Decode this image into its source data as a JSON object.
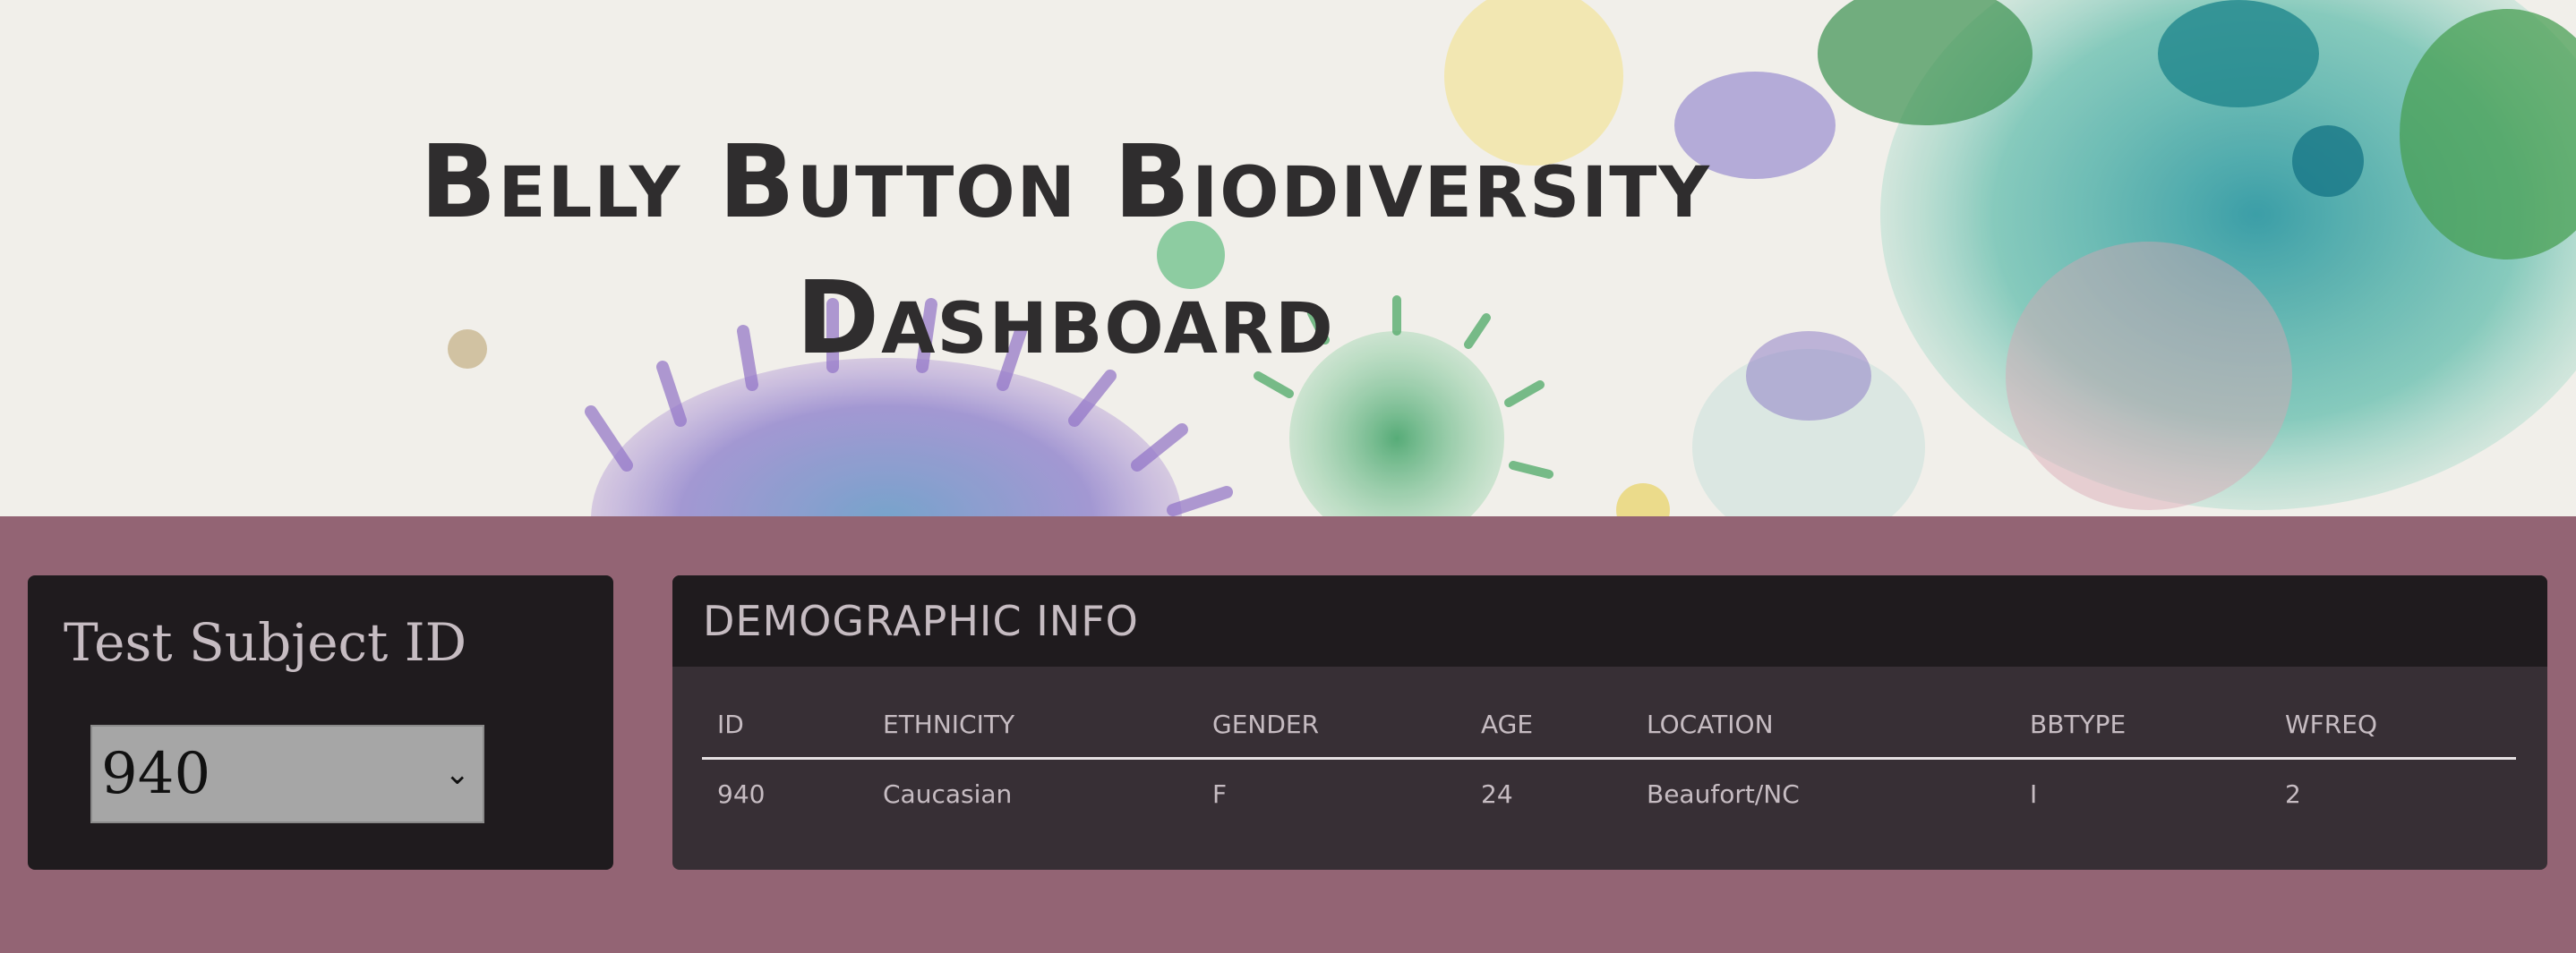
{
  "header": {
    "title_line1": "Belly Button Biodiversity",
    "title_line2": "Dashboard"
  },
  "subject": {
    "title": "Test Subject ID",
    "selected": "940"
  },
  "demographics": {
    "heading": "DEMOGRAPHIC INFO",
    "columns": [
      "ID",
      "ETHNICITY",
      "GENDER",
      "AGE",
      "LOCATION",
      "BBTYPE",
      "WFREQ"
    ],
    "rows": [
      [
        "940",
        "Caucasian",
        "F",
        "24",
        "Beaufort/NC",
        "I",
        "2"
      ]
    ]
  },
  "colors": {
    "panel_bg": "#936474",
    "card_dark": "#1f1b1e",
    "table_bg": "#372f35",
    "text_light": "#c6bcc2",
    "title_text": "#2f2d2e"
  }
}
